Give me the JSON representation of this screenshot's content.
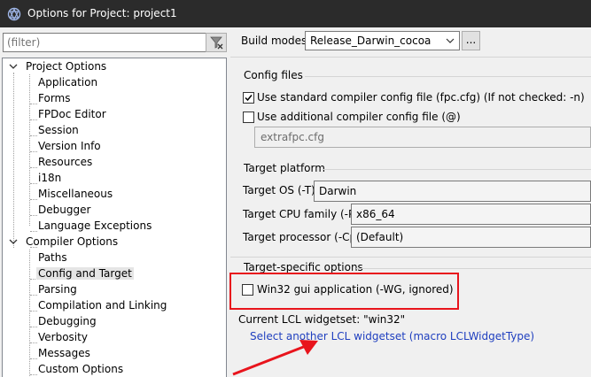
{
  "window": {
    "title": "Options for Project: project1"
  },
  "filter": {
    "placeholder": "(filter)"
  },
  "tree": {
    "project_options": "Project Options",
    "project_items": [
      "Application",
      "Forms",
      "FPDoc Editor",
      "Session",
      "Version Info",
      "Resources",
      "i18n",
      "Miscellaneous",
      "Debugger",
      "Language Exceptions"
    ],
    "compiler_options": "Compiler Options",
    "compiler_items": [
      "Paths",
      "Config and Target",
      "Parsing",
      "Compilation and Linking",
      "Debugging",
      "Verbosity",
      "Messages",
      "Custom Options"
    ],
    "selected": "Config and Target"
  },
  "build_modes": {
    "label": "Build modes",
    "value": "Release_Darwin_cocoa",
    "more_button": "..."
  },
  "config_files": {
    "title": "Config files",
    "use_standard": "Use standard compiler config file (fpc.cfg) (If not checked: -n)",
    "use_standard_checked": true,
    "use_additional": "Use additional compiler config file (@)",
    "use_additional_checked": false,
    "additional_file": "extrafpc.cfg"
  },
  "target_platform": {
    "title": "Target platform",
    "os_label": "Target OS (-T)",
    "os_value": "Darwin",
    "cpu_label": "Target CPU family (-P)",
    "cpu_value": "x86_64",
    "processor_label": "Target processor (-Cp)",
    "processor_value": "(Default)"
  },
  "target_specific": {
    "title": "Target-specific options",
    "win32_gui": "Win32 gui application (-WG, ignored)",
    "win32_gui_checked": false
  },
  "lcl": {
    "current": "Current LCL widgetset: \"win32\"",
    "select_link": "Select another LCL widgetset (macro LCLWidgetType)"
  },
  "annotation": {
    "highlight_color": "#e8141c"
  }
}
